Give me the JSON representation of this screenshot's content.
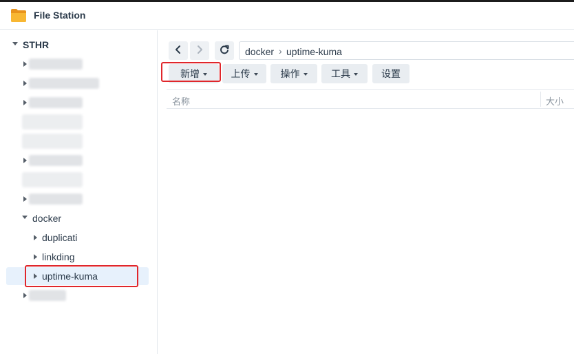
{
  "app": {
    "title": "File Station",
    "icon": "folder-icon"
  },
  "colors": {
    "highlight_box": "#e0262b",
    "selected_row": "#e7f1fc",
    "folder": "#f5a623"
  },
  "sidebar": {
    "root": "STHR",
    "items": [
      {
        "label": "docker",
        "expanded": true,
        "children": [
          {
            "label": "duplicati"
          },
          {
            "label": "linkding"
          },
          {
            "label": "uptime-kuma",
            "selected": true
          }
        ]
      }
    ]
  },
  "nav": {
    "back_icon": "chevron-left-icon",
    "forward_icon": "chevron-right-icon",
    "refresh_icon": "refresh-icon"
  },
  "path": {
    "segments": [
      "docker",
      "uptime-kuma"
    ],
    "separator": "›"
  },
  "toolbar": {
    "create_label": "新增",
    "upload_label": "上传",
    "action_label": "操作",
    "tools_label": "工具",
    "settings_label": "设置"
  },
  "list": {
    "columns": [
      "名称",
      "大小"
    ],
    "rows": []
  }
}
